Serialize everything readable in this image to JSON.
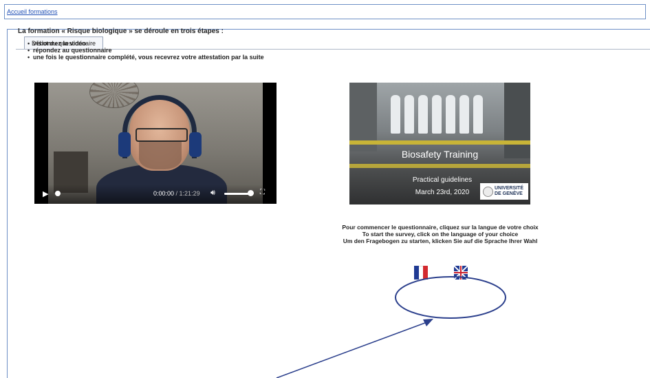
{
  "header": {
    "breadcrumb": "Accueil formations"
  },
  "tabs": [
    {
      "label": "Début du questionnaire"
    }
  ],
  "intro": {
    "heading": "La formation « Risque biologique » se déroule en trois étapes :",
    "steps": [
      "visionnez la vidéo",
      "répondez au questionnaire",
      "une fois le questionnaire complété, vous recevrez votre attestation par la suite"
    ]
  },
  "video": {
    "current_time": "0:00:00",
    "duration": "1:21:29",
    "progress": 0.0,
    "volume": 1.0
  },
  "slide": {
    "title": "Biosafety Training",
    "subtitle": "Practical guidelines",
    "date": "March 23rd, 2020",
    "logo_line1": "UNIVERSITÉ",
    "logo_line2": "DE GENÈVE"
  },
  "instructions": {
    "fr": "Pour commencer le questionnaire, cliquez sur la langue de votre choix",
    "en": "To start the survey, click on the language of your choice",
    "de": "Um den Fragebogen zu starten, klicken Sie auf die Sprache Ihrer Wahl"
  },
  "languages": [
    {
      "id": "fr",
      "icon": "flag-france-icon"
    },
    {
      "id": "en",
      "icon": "flag-uk-icon"
    }
  ],
  "colors": {
    "link": "#1f4fb5",
    "border": "#6d8fc6",
    "annotation": "#2b3f8c"
  }
}
